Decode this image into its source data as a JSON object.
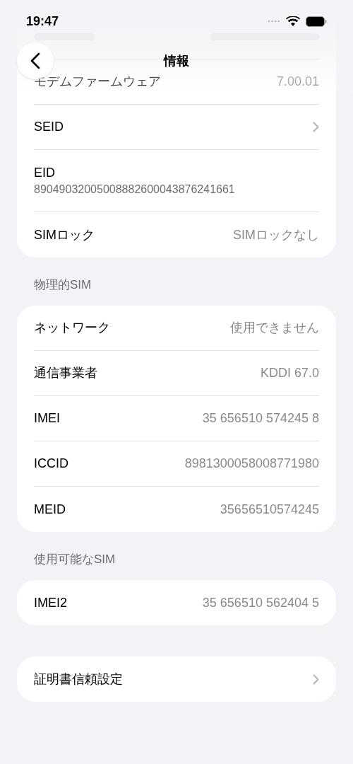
{
  "status_bar": {
    "time": "19:47"
  },
  "nav": {
    "title": "情報"
  },
  "sections": [
    {
      "rows": [
        {
          "kind": "obscured"
        },
        {
          "kind": "value",
          "label": "モデムファームウェア",
          "value": "7.00.01"
        },
        {
          "kind": "chevron",
          "label": "SEID"
        },
        {
          "kind": "stacked",
          "label": "EID",
          "value": "89049032005008882600043876241661"
        },
        {
          "kind": "value",
          "label": "SIMロック",
          "value": "SIMロックなし"
        }
      ]
    },
    {
      "header": "物理的SIM",
      "rows": [
        {
          "kind": "value",
          "label": "ネットワーク",
          "value": "使用できません"
        },
        {
          "kind": "value",
          "label": "通信事業者",
          "value": "KDDI 67.0"
        },
        {
          "kind": "value",
          "label": "IMEI",
          "value": "35 656510 574245 8"
        },
        {
          "kind": "value",
          "label": "ICCID",
          "value": "8981300058008771980"
        },
        {
          "kind": "value",
          "label": "MEID",
          "value": "35656510574245"
        }
      ]
    },
    {
      "header": "使用可能なSIM",
      "rows": [
        {
          "kind": "value",
          "label": "IMEI2",
          "value": "35 656510 562404 5"
        }
      ]
    },
    {
      "rows": [
        {
          "kind": "chevron",
          "label": "証明書信頼設定"
        }
      ]
    }
  ]
}
